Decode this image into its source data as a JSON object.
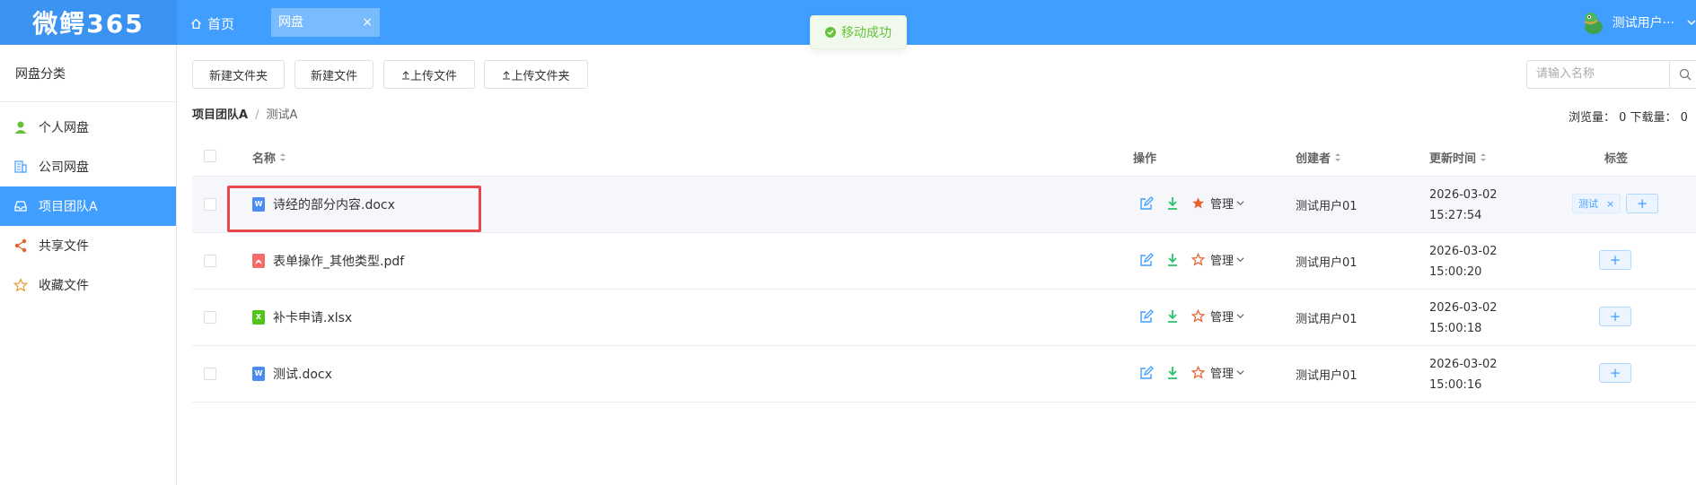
{
  "header": {
    "logo": "微鳄365",
    "home_label": "首页",
    "tab_label": "网盘",
    "tab_close": "×",
    "user_name": "测试用户···"
  },
  "toast": {
    "message": "移动成功"
  },
  "sidebar": {
    "title": "网盘分类",
    "items": [
      {
        "label": "个人网盘",
        "icon": "user-icon"
      },
      {
        "label": "公司网盘",
        "icon": "building-icon"
      },
      {
        "label": "项目团队A",
        "icon": "inbox-icon",
        "active": true
      },
      {
        "label": "共享文件",
        "icon": "share-icon"
      },
      {
        "label": "收藏文件",
        "icon": "star-icon"
      }
    ]
  },
  "toolbar": {
    "new_folder": "新建文件夹",
    "new_file": "新建文件",
    "upload_file": "上传文件",
    "upload_folder": "上传文件夹",
    "search_placeholder": "请输入名称"
  },
  "breadcrumb": {
    "root": "项目团队A",
    "sep": "/",
    "current": "测试A"
  },
  "stats": {
    "text": "浏览量： 0   下载量： 0"
  },
  "table": {
    "headers": {
      "name": "名称",
      "ops": "操作",
      "creator": "创建者",
      "time": "更新时间",
      "tags": "标签"
    },
    "manage_label": "管理",
    "rows": [
      {
        "name": "诗经的部分内容.docx",
        "type": "word",
        "icon_letter": "W",
        "starred": true,
        "creator": "测试用户01",
        "date": "2026-03-02",
        "time": "15:27:54",
        "tag": "测试",
        "tag_close": "×"
      },
      {
        "name": "表单操作_其他类型.pdf",
        "type": "pdf",
        "icon_letter": "",
        "starred": false,
        "creator": "测试用户01",
        "date": "2026-03-02",
        "time": "15:00:20"
      },
      {
        "name": "补卡申请.xlsx",
        "type": "excel",
        "icon_letter": "X",
        "starred": false,
        "creator": "测试用户01",
        "date": "2026-03-02",
        "time": "15:00:18"
      },
      {
        "name": "测试.docx",
        "type": "word",
        "icon_letter": "W",
        "starred": false,
        "creator": "测试用户01",
        "date": "2026-03-02",
        "time": "15:00:16"
      }
    ]
  },
  "colors": {
    "primary": "#409eff",
    "success": "#67c23a",
    "danger": "#e8474b",
    "star": "#e6612c",
    "download": "#2bc36b"
  }
}
